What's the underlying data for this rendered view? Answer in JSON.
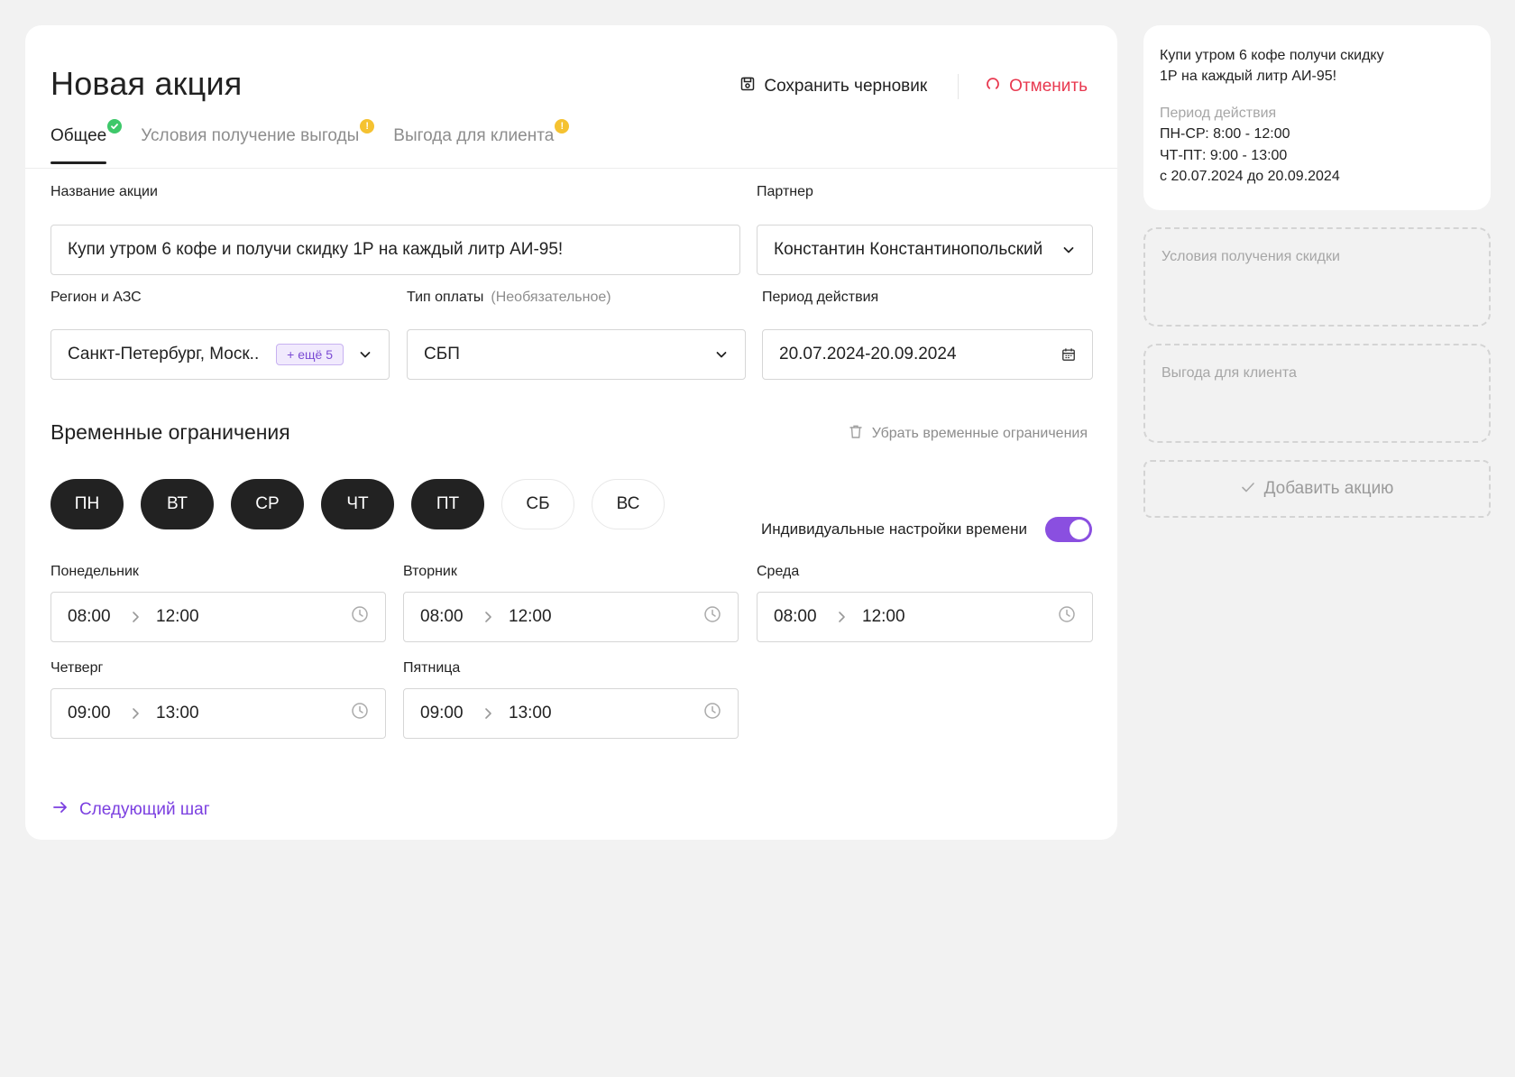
{
  "header": {
    "title": "Новая акция",
    "save_draft": "Сохранить черновик",
    "cancel": "Отменить"
  },
  "tabs": [
    {
      "label": "Общее",
      "status": "ok"
    },
    {
      "label": "Условия получение выгоды",
      "status": "warn",
      "badge": "!"
    },
    {
      "label": "Выгода для клиента",
      "status": "warn",
      "badge": "!"
    }
  ],
  "form": {
    "name_label": "Название акции",
    "name_value": "Купи утром 6 кофе и получи скидку 1Р на каждый литр АИ-95!",
    "partner_label": "Партнер",
    "partner_value": "Константин Константинопольский",
    "region_label": "Регион и АЗС",
    "region_value": "Санкт-Петербург, Моск...",
    "region_more": "+ ещё 5",
    "payment_label": "Тип оплаты",
    "payment_optional": "(Необязательное)",
    "payment_value": "СБП",
    "period_label": "Период действия",
    "period_value": "20.07.2024-20.09.2024"
  },
  "time_limits": {
    "title": "Временные ограничения",
    "remove": "Убрать временные ограничения",
    "days": [
      {
        "label": "ПН",
        "selected": true
      },
      {
        "label": "ВТ",
        "selected": true
      },
      {
        "label": "СР",
        "selected": true
      },
      {
        "label": "ЧТ",
        "selected": true
      },
      {
        "label": "ПТ",
        "selected": true
      },
      {
        "label": "СБ",
        "selected": false
      },
      {
        "label": "ВС",
        "selected": false
      }
    ],
    "individual_label": "Индивидуальные настройки времени",
    "individual_on": true,
    "schedule": [
      {
        "day": "Понедельник",
        "from": "08:00",
        "to": "12:00"
      },
      {
        "day": "Вторник",
        "from": "08:00",
        "to": "12:00"
      },
      {
        "day": "Среда",
        "from": "08:00",
        "to": "12:00"
      },
      {
        "day": "Четверг",
        "from": "09:00",
        "to": "13:00"
      },
      {
        "day": "Пятница",
        "from": "09:00",
        "to": "13:00"
      }
    ]
  },
  "next_step": "Следующий шаг",
  "summary": {
    "title_line1": "Купи утром 6 кофе получи скидку",
    "title_line2": "1Р на каждый литр АИ-95!",
    "period_label": "Период действия",
    "lines": [
      "ПН-СР: 8:00 - 12:00",
      "ЧТ-ПТ: 9:00 - 13:00",
      "с 20.07.2024 до 20.09.2024"
    ]
  },
  "placeholders": {
    "conditions": "Условия получения скидки",
    "benefit": "Выгода для клиента"
  },
  "add_button": "Добавить акцию",
  "colors": {
    "accent": "#8a4fe0",
    "cancel": "#e8384f",
    "ok": "#3ec86a",
    "warn": "#f5c231",
    "day_selected": "#222222"
  }
}
